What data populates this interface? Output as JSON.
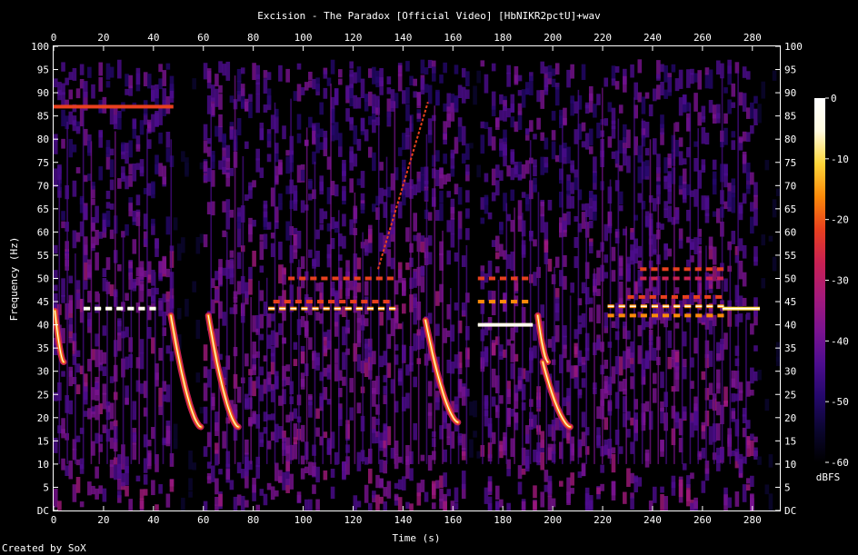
{
  "title": "Excision - The Paradox [Official Video] [HbNIKR2pctU]+wav",
  "footer": "Created by SoX",
  "colors": {
    "background": "#000000",
    "text": "#ffffff",
    "scale": [
      "#000000",
      "#0b0630",
      "#24086b",
      "#4d0d8f",
      "#7a1391",
      "#a3197c",
      "#c92152",
      "#e8401e",
      "#fb8a0a",
      "#fed63a",
      "#fffbe0",
      "#ffffff"
    ]
  },
  "chart_data": {
    "type": "heatmap",
    "title": "Excision - The Paradox [Official Video] [HbNIKR2pctU]+wav",
    "xlabel": "Time (s)",
    "ylabel": "Frequency (Hz)",
    "xlim": [
      0,
      291
    ],
    "ylim": [
      0,
      100
    ],
    "x_ticks": [
      0,
      20,
      40,
      60,
      80,
      100,
      120,
      140,
      160,
      180,
      200,
      220,
      240,
      260,
      280
    ],
    "y_ticks": [
      0,
      5,
      10,
      15,
      20,
      25,
      30,
      35,
      40,
      45,
      50,
      55,
      60,
      65,
      70,
      75,
      80,
      85,
      90,
      95,
      100
    ],
    "y_tick_labels": [
      "DC",
      "5",
      "10",
      "15",
      "20",
      "25",
      "30",
      "35",
      "40",
      "45",
      "50",
      "55",
      "60",
      "65",
      "70",
      "75",
      "80",
      "85",
      "90",
      "95",
      "100"
    ],
    "colorbar": {
      "label": "dBFS",
      "range": [
        -60,
        0
      ],
      "ticks": [
        0,
        -10,
        -20,
        -30,
        -40,
        -50,
        -60
      ]
    },
    "sweeps": [
      {
        "t0": 0.5,
        "t1": 4,
        "f0": 43,
        "f1": 32
      },
      {
        "t0": 47,
        "t1": 59,
        "f0": 42,
        "f1": 18
      },
      {
        "t0": 62,
        "t1": 74,
        "f0": 42,
        "f1": 18
      },
      {
        "t0": 149,
        "t1": 162,
        "f0": 41,
        "f1": 19
      },
      {
        "t0": 194,
        "t1": 198,
        "f0": 42,
        "f1": 32
      },
      {
        "t0": 196,
        "t1": 207,
        "f0": 32,
        "f1": 18
      }
    ],
    "tones": [
      {
        "t0": 0,
        "t1": 48,
        "f": 87,
        "level": -22
      },
      {
        "t0": 12,
        "t1": 40,
        "f": 43.5,
        "level": -8,
        "pulsed": true
      },
      {
        "t0": 86,
        "t1": 135,
        "f": 43.5,
        "level": -14,
        "pulsed": true
      },
      {
        "t0": 88,
        "t1": 135,
        "f": 45,
        "level": -22,
        "pulsed": true
      },
      {
        "t0": 94,
        "t1": 135,
        "f": 50,
        "level": -24,
        "pulsed": true
      },
      {
        "t0": 170,
        "t1": 192,
        "f": 40,
        "level": -6
      },
      {
        "t0": 170,
        "t1": 192,
        "f": 45,
        "level": -18,
        "pulsed": true
      },
      {
        "t0": 170,
        "t1": 192,
        "f": 50,
        "level": -20,
        "pulsed": true
      },
      {
        "t0": 222,
        "t1": 268,
        "f": 44,
        "level": -14,
        "pulsed": true
      },
      {
        "t0": 222,
        "t1": 268,
        "f": 42,
        "level": -18,
        "pulsed": true
      },
      {
        "t0": 230,
        "t1": 268,
        "f": 46,
        "level": -22,
        "pulsed": true
      },
      {
        "t0": 235,
        "t1": 268,
        "f": 50,
        "level": -26,
        "pulsed": true
      },
      {
        "t0": 235,
        "t1": 268,
        "f": 52,
        "level": -24,
        "pulsed": true
      },
      {
        "t0": 268,
        "t1": 283,
        "f": 43.5,
        "level": -10
      }
    ],
    "rising_line": {
      "t0": 130,
      "t1": 150,
      "f0": 52,
      "f1": 88,
      "level": -22
    }
  }
}
